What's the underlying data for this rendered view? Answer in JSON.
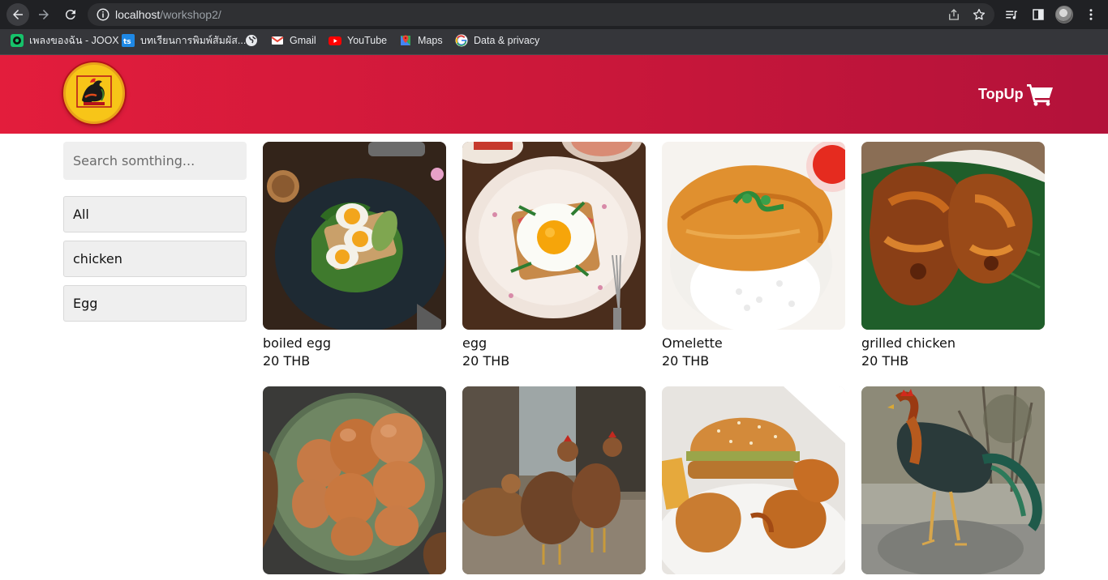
{
  "browser": {
    "url_host": "localhost",
    "url_path": "/workshop2/",
    "bookmarks": [
      {
        "label": "เพลงของฉัน - JOOX",
        "icon": "joox-icon"
      },
      {
        "label": "บทเรียนการพิมพ์สัมผัส...",
        "icon": "typing-site-icon"
      },
      {
        "label": "",
        "icon": "globe-icon"
      },
      {
        "label": "Gmail",
        "icon": "gmail-icon"
      },
      {
        "label": "YouTube",
        "icon": "youtube-icon"
      },
      {
        "label": "Maps",
        "icon": "maps-icon"
      },
      {
        "label": "Data & privacy",
        "icon": "google-icon"
      }
    ]
  },
  "header": {
    "topup_label": "TopUp",
    "gradient_start": "#e31d3c",
    "gradient_end": "#b3123a"
  },
  "sidebar": {
    "search_placeholder": "Search somthing...",
    "categories": [
      "All",
      "chicken",
      "Egg"
    ]
  },
  "products": [
    {
      "name": "boiled egg",
      "price": "20 THB",
      "image": "boiled-egg-toast-photo"
    },
    {
      "name": "egg",
      "price": "20 THB",
      "image": "fried-egg-toast-photo"
    },
    {
      "name": "Omelette",
      "price": "20 THB",
      "image": "omelette-rice-photo"
    },
    {
      "name": "grilled chicken",
      "price": "20 THB",
      "image": "grilled-chicken-photo"
    },
    {
      "name": "",
      "price": "",
      "image": "bowl-of-eggs-photo"
    },
    {
      "name": "",
      "price": "",
      "image": "hens-photo"
    },
    {
      "name": "",
      "price": "",
      "image": "burger-fried-chicken-photo"
    },
    {
      "name": "",
      "price": "",
      "image": "rooster-photo"
    }
  ]
}
